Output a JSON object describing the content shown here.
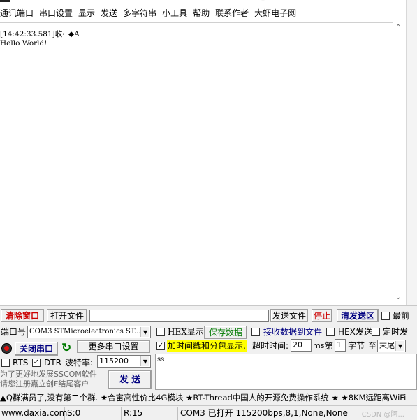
{
  "menu": [
    "通讯端口",
    "串口设置",
    "显示",
    "发送",
    "多字符串",
    "小工具",
    "帮助",
    "联系作者",
    "大虾电子网"
  ],
  "receive": {
    "lines": [
      "[14:42:33.581]收←◆A",
      "Hello World!"
    ]
  },
  "toolbar": {
    "clear_label": "清除窗口",
    "open_file_label": "打开文件",
    "file_path_value": "",
    "send_file_label": "发送文件",
    "stop_label": "停止",
    "clear_send_label": "清发送区",
    "last_label": "最前"
  },
  "port": {
    "label": "端口号",
    "selected": "COM3 STMicroelectronics ST...",
    "more_settings": "更多串口设置",
    "close_label": "关闭串口",
    "rts_label": "RTS",
    "dtr_label": "DTR",
    "rts_checked": false,
    "dtr_checked": true,
    "baud_label": "波特率:",
    "baud_value": "115200"
  },
  "options": {
    "hex_display": "HEX显示",
    "save_data": "保存数据",
    "recv_to_file": "接收数据到文件",
    "hex_send": "HEX发送",
    "timed_send": "定时发",
    "timestamp": "加时间戳和分包显示,",
    "timeout_label": "超时时间:",
    "timeout_value": "20",
    "ms": "ms",
    "nth_label": "第",
    "nth_value": "1",
    "byte_label": "字节",
    "to_label": "至",
    "end_value": "末尾"
  },
  "send": {
    "text": "ss",
    "button_label": "发  送"
  },
  "promo": {
    "line1": "为了更好地发展SSCOM软件",
    "line2": "请您注册嘉立创F结尾客户"
  },
  "ticker": "▲Q群满员了,没有第二个群. ★合宙高性价比4G模块 ★RT-Thread中国人的开源免费操作系统 ★ ★8KM远距离WiFi",
  "status": {
    "website": "www.daxia.com",
    "sent": "S:0",
    "received": "R:15",
    "port_state": "COM3 已打开  115200bps,8,1,None,None",
    "watermark": "CSDN @阿..."
  },
  "colors": {
    "red_text": "#cc0000",
    "green_text": "#007a00",
    "navy_text": "#000080",
    "highlight": "#ffff00"
  }
}
